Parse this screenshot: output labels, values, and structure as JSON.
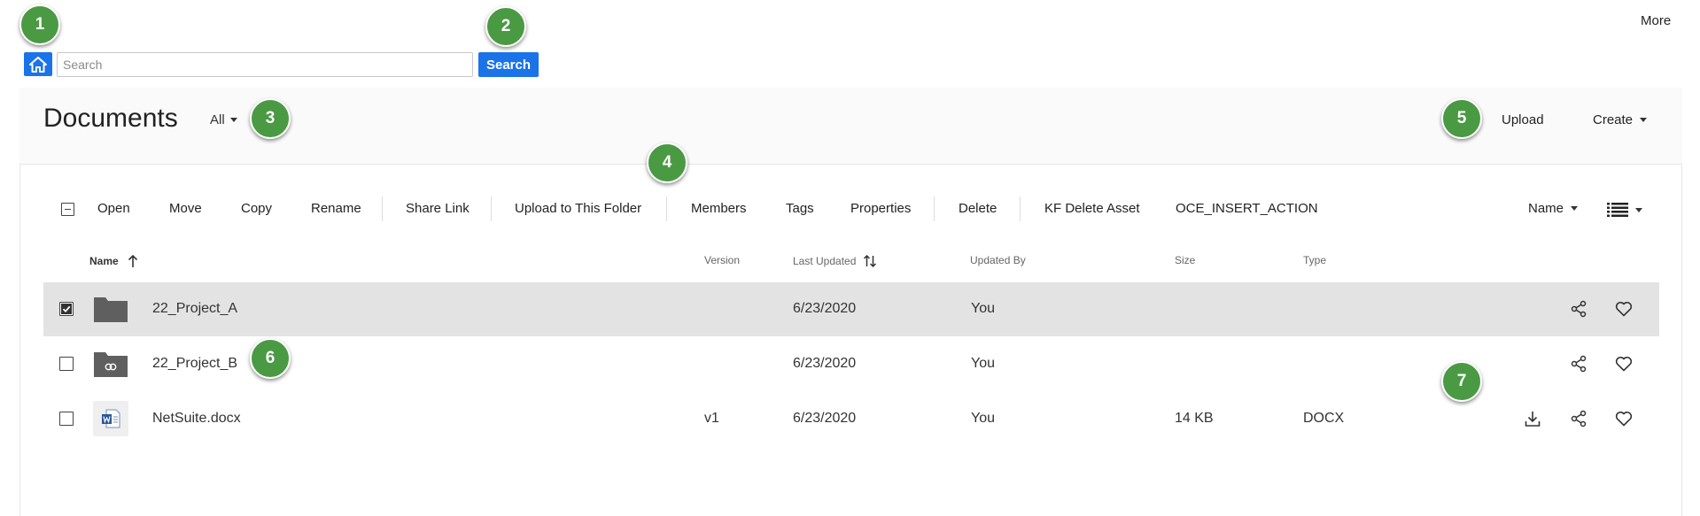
{
  "topbar": {
    "search_placeholder": "Search",
    "search_button": "Search",
    "more": "More"
  },
  "header": {
    "title": "Documents",
    "filter": "All",
    "upload": "Upload",
    "create": "Create"
  },
  "toolbar": {
    "items": [
      "Open",
      "Move",
      "Copy",
      "Rename",
      "Share Link",
      "Upload to This Folder",
      "Members",
      "Tags",
      "Properties",
      "Delete",
      "KF Delete Asset",
      "OCE_INSERT_ACTION"
    ],
    "sort_by": "Name"
  },
  "columns": {
    "name": "Name",
    "version": "Version",
    "last_updated": "Last Updated",
    "updated_by": "Updated By",
    "size": "Size",
    "type": "Type"
  },
  "rows": [
    {
      "name": "22_Project_A",
      "version": "",
      "last_updated": "6/23/2020",
      "updated_by": "You",
      "size": "",
      "type": "",
      "kind": "folder",
      "selected": true
    },
    {
      "name": "22_Project_B",
      "version": "",
      "last_updated": "6/23/2020",
      "updated_by": "You",
      "size": "",
      "type": "",
      "kind": "shared-folder",
      "selected": false
    },
    {
      "name": "NetSuite.docx",
      "version": "v1",
      "last_updated": "6/23/2020",
      "updated_by": "You",
      "size": "14 KB",
      "type": "DOCX",
      "kind": "word-document",
      "selected": false
    }
  ],
  "callouts": [
    "1",
    "2",
    "3",
    "4",
    "5",
    "6",
    "7"
  ],
  "colors": {
    "accent": "#1a73e8",
    "callout": "#4a9a43",
    "selected_row": "#e3e3e3"
  }
}
